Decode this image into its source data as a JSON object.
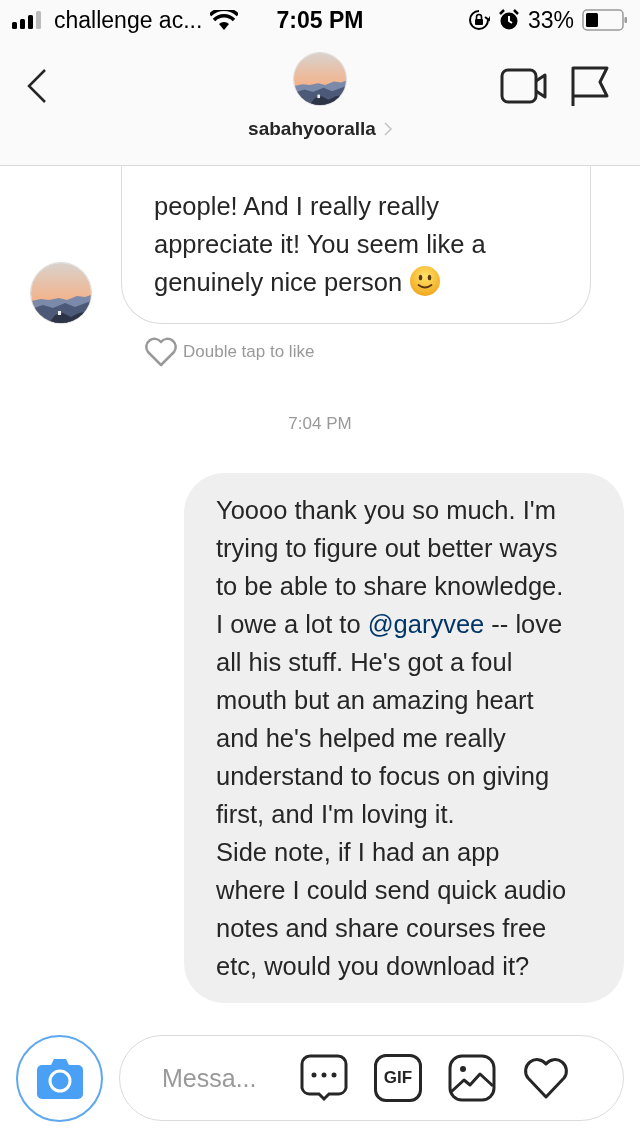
{
  "status_bar": {
    "carrier": "challenge ac...",
    "time": "7:05 PM",
    "battery": "33%"
  },
  "header": {
    "username": "sabahyooralla"
  },
  "received": {
    "lines": [
      "people! And I really really",
      "appreciate it! You seem like a",
      "genuinely nice person"
    ],
    "smiley": true,
    "like_hint": "Double tap to like"
  },
  "timestamp": "7:04 PM",
  "sent": {
    "paragraphs": [
      {
        "lines": [
          [
            "Yoooo thank you so much. I'm"
          ],
          [
            "trying to figure out better ways"
          ],
          [
            "to be able to share knowledge."
          ],
          [
            {
              "text": "I owe a lot to "
            },
            {
              "text": "@garyvee",
              "kind": "mention"
            },
            {
              "text": " -- love"
            }
          ],
          [
            "all his stuff. He's got a foul"
          ],
          [
            "mouth but an amazing heart"
          ],
          [
            "and he's helped me really"
          ],
          [
            "understand to focus on giving"
          ],
          [
            "first, and I'm loving it."
          ]
        ]
      },
      {
        "lines": [
          [
            "Side note, if I had an app"
          ],
          [
            "where I could send quick audio"
          ],
          [
            "notes and share courses free"
          ],
          [
            "etc, would you download it?"
          ]
        ]
      }
    ]
  },
  "composer": {
    "placeholder": "Messa...",
    "gif_label": "GIF"
  }
}
